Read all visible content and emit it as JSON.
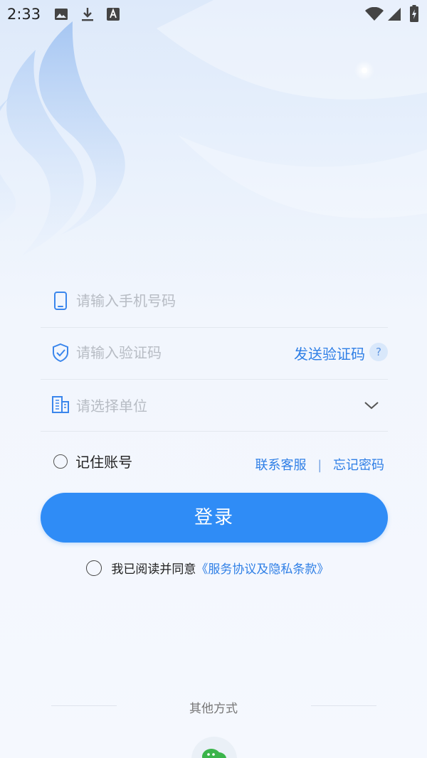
{
  "status_bar": {
    "time": "2:33",
    "icons": [
      "image-icon",
      "download-icon",
      "font-icon",
      "wifi-icon",
      "signal-icon",
      "battery-icon"
    ]
  },
  "form": {
    "phone": {
      "placeholder": "请输入手机号码",
      "icon": "phone-icon",
      "value": ""
    },
    "code": {
      "placeholder": "请输入验证码",
      "icon": "shield-check-icon",
      "send_label": "发送验证码",
      "help_label": "?",
      "value": ""
    },
    "unit": {
      "placeholder": "请选择单位",
      "icon": "building-icon",
      "dropdown_icon": "chevron-down-icon"
    }
  },
  "remember": {
    "label": "记住账号",
    "checked": false
  },
  "links": {
    "contact": "联系客服",
    "separator": "|",
    "forgot": "忘记密码"
  },
  "login_button": {
    "label": "登录"
  },
  "agreement": {
    "prefix": "我已阅读并同意",
    "link": "《服务协议及隐私条款》",
    "checked": false
  },
  "other": {
    "label": "其他方式",
    "methods": [
      "wechat-icon"
    ]
  },
  "colors": {
    "primary": "#2f8cf6",
    "link": "#2f7fe6",
    "placeholder": "#b7bcc4",
    "background": "#f3f7fd"
  }
}
